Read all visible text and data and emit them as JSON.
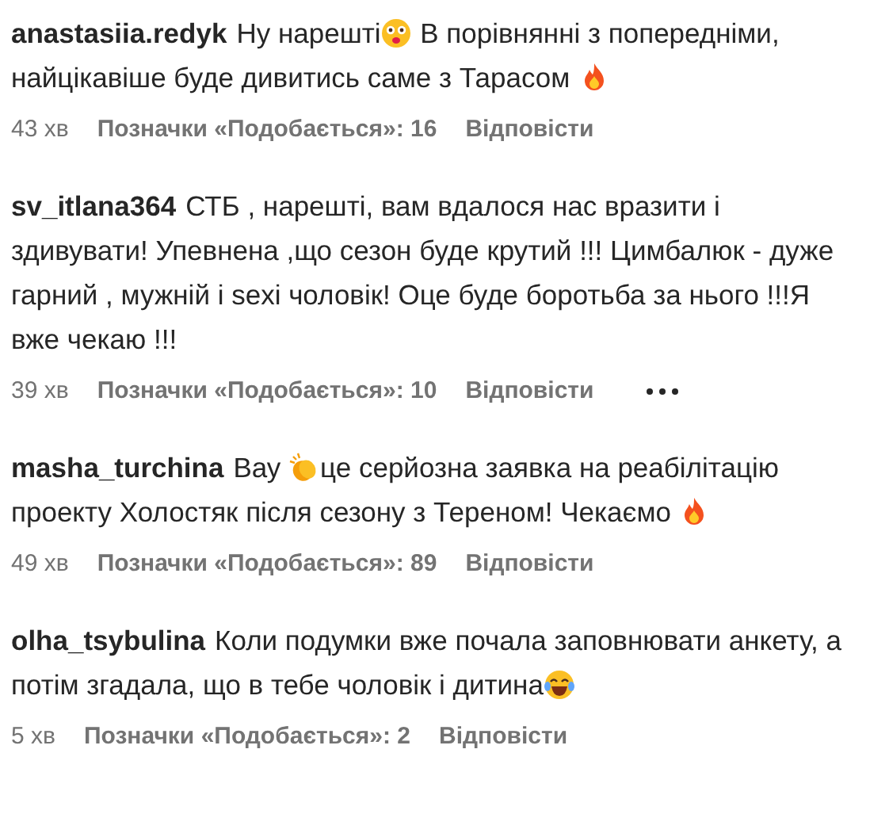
{
  "comments": [
    {
      "user": "anastasiia.redyk",
      "body": [
        {
          "kind": "text",
          "text": "Ну нарешті"
        },
        {
          "kind": "flushed"
        },
        {
          "kind": "text",
          "text": "  В порівнянні з попередніми, найцікавіше буде дивитись саме з Тарасом "
        },
        {
          "kind": "fire"
        }
      ],
      "time": "43 хв",
      "likes": "Позначки «Подобається»: 16",
      "reply": "Відповісти",
      "more": false
    },
    {
      "user": "sv_itlana364",
      "body": [
        {
          "kind": "text",
          "text": "СТБ , нарешті, вам вдалося нас вразити і здивувати! Упевнена ,що сезон буде крутий !!! Цимбалюк - дуже гарний , мужній і sexi чоловік! Оце буде боротьба за нього !!!Я вже чекаю !!!"
        }
      ],
      "time": "39 хв",
      "likes": "Позначки «Подобається»: 10",
      "reply": "Відповісти",
      "more": true
    },
    {
      "user": "masha_turchina",
      "body": [
        {
          "kind": "text",
          "text": "Вау "
        },
        {
          "kind": "clap"
        },
        {
          "kind": "text",
          "text": "це серйозна заявка на реабілітацію проекту Холостяк після сезону з Тереном! Чекаємо  "
        },
        {
          "kind": "fire"
        }
      ],
      "time": "49 хв",
      "likes": "Позначки «Подобається»: 89",
      "reply": "Відповісти",
      "more": false
    },
    {
      "user": "olha_tsybulina",
      "body": [
        {
          "kind": "text",
          "text": "Коли подумки вже почала заповнювати анкету, а потім згадала, що в тебе чоловік і дитина"
        },
        {
          "kind": "laugh"
        }
      ],
      "time": "5 хв",
      "likes": "Позначки «Подобається»: 2",
      "reply": "Відповісти",
      "more": false
    }
  ]
}
